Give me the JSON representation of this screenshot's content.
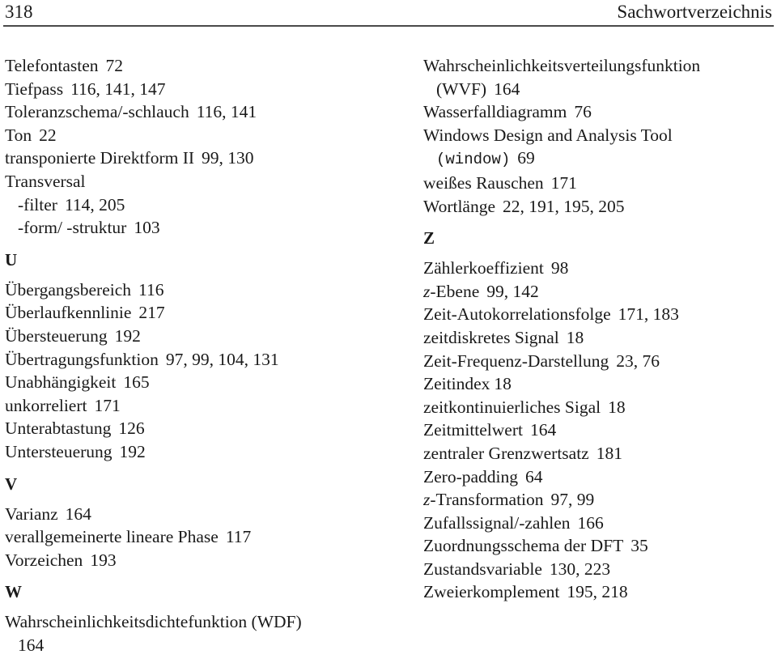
{
  "header": {
    "page_number": "318",
    "running_title": "Sachwortverzeichnis"
  },
  "left_column": {
    "t_entries": [
      {
        "term": "Telefontasten",
        "pages": "72"
      },
      {
        "term": "Tiefpass",
        "pages": "116, 141, 147"
      },
      {
        "term": "Toleranzschema/-schlauch",
        "pages": "116, 141"
      },
      {
        "term": "Ton",
        "pages": "22"
      },
      {
        "term": "transponierte Direktform II",
        "pages": "99, 130"
      },
      {
        "term": "Transversal",
        "pages": ""
      }
    ],
    "t_subentries": [
      {
        "term": "-filter",
        "pages": "114, 205"
      },
      {
        "term": "-form/ -struktur",
        "pages": "103"
      }
    ],
    "letter_u": "U",
    "u_entries": [
      {
        "term": "Übergangsbereich",
        "pages": "116"
      },
      {
        "term": "Überlaufkennlinie",
        "pages": "217"
      },
      {
        "term": "Übersteuerung",
        "pages": "192"
      },
      {
        "term": "Übertragungsfunktion",
        "pages": "97, 99, 104, 131"
      },
      {
        "term": "Unabhängigkeit",
        "pages": "165"
      },
      {
        "term": "unkorreliert",
        "pages": "171"
      },
      {
        "term": "Unterabtastung",
        "pages": "126"
      },
      {
        "term": "Untersteuerung",
        "pages": "192"
      }
    ],
    "letter_v": "V",
    "v_entries": [
      {
        "term": "Varianz",
        "pages": "164"
      },
      {
        "term": "verallgemeinerte lineare Phase",
        "pages": "117"
      },
      {
        "term": "Vorzeichen",
        "pages": "193"
      }
    ],
    "letter_w": "W",
    "w_entries": [
      {
        "term": "Wahrscheinlichkeitsdichtefunktion (WDF)",
        "pages": "164"
      }
    ]
  },
  "right_column": {
    "w_entries": [
      {
        "term": "Wahrscheinlichkeitsverteilungsfunktion",
        "continuation": "(WVF)",
        "pages": "164"
      },
      {
        "term": "Wasserfalldiagramm",
        "pages": "76"
      },
      {
        "term": "Windows Design and Analysis Tool",
        "continuation_code": "(window)",
        "pages": "69"
      },
      {
        "term": "weißes Rauschen",
        "pages": "171"
      },
      {
        "term": "Wortlänge",
        "pages": "22, 191, 195, 205"
      }
    ],
    "letter_z": "Z",
    "z_entries": [
      {
        "term": "Zählerkoeffizient",
        "pages": "98"
      },
      {
        "term_italic": "z",
        "term": "-Ebene",
        "pages": "99, 142"
      },
      {
        "term": "Zeit-Autokorrelationsfolge",
        "pages": "171, 183"
      },
      {
        "term": "zeitdiskretes Signal",
        "pages": "18"
      },
      {
        "term": "Zeit-Frequenz-Darstellung",
        "pages": "23, 76"
      },
      {
        "term": "Zeitindex",
        "pages": "18"
      },
      {
        "term": "zeitkontinuierliches Sigal",
        "pages": "18"
      },
      {
        "term": "Zeitmittelwert",
        "pages": "164"
      },
      {
        "term": "zentraler Grenzwertsatz",
        "pages": "181"
      },
      {
        "term": "Zero-padding",
        "pages": "64"
      },
      {
        "term_italic": "z",
        "term": "-Transformation",
        "pages": "97, 99"
      },
      {
        "term": "Zufallssignal/-zahlen",
        "pages": "166"
      },
      {
        "term": "Zuordnungsschema der DFT",
        "pages": "35"
      },
      {
        "term": "Zustandsvariable",
        "pages": "130, 223"
      },
      {
        "term": "Zweierkomplement",
        "pages": "195, 218"
      }
    ]
  }
}
